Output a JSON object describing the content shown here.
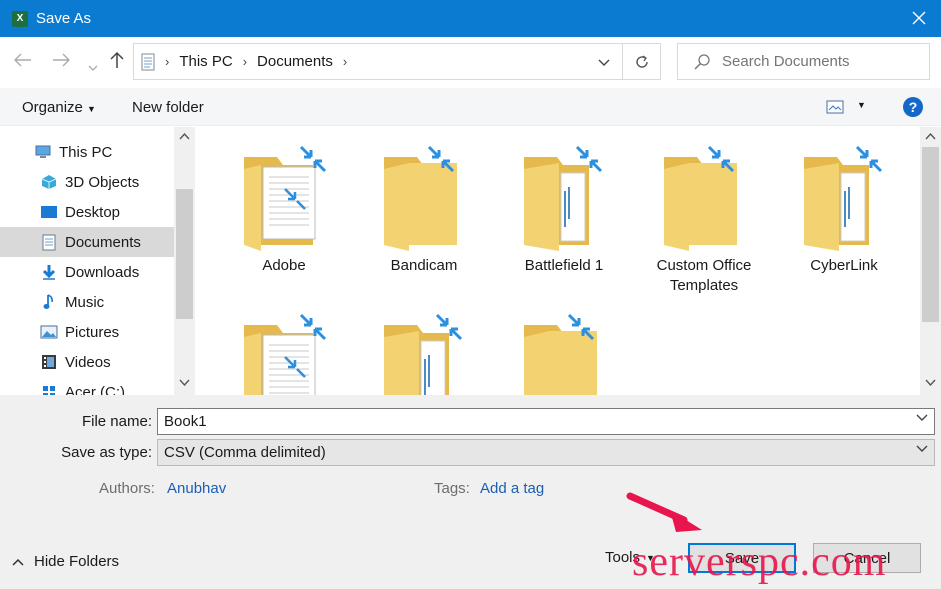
{
  "window": {
    "title": "Save As",
    "app_icon": "excel-icon",
    "close_icon": "close-icon"
  },
  "nav": {
    "back_icon": "back-arrow-icon",
    "forward_icon": "forward-arrow-icon",
    "recent_icon": "chevron-down-icon",
    "up_icon": "up-arrow-icon"
  },
  "address": {
    "crumbs": [
      "This PC",
      "Documents"
    ],
    "refresh_icon": "refresh-icon"
  },
  "search": {
    "placeholder": "Search Documents"
  },
  "toolbar": {
    "organize": "Organize",
    "new_folder": "New folder",
    "view_icon": "view-options-icon",
    "help": "?"
  },
  "sidebar": {
    "items": [
      {
        "label": "This PC",
        "icon": "computer-icon",
        "selected": false
      },
      {
        "label": "3D Objects",
        "icon": "cube-icon",
        "selected": false
      },
      {
        "label": "Desktop",
        "icon": "desktop-icon",
        "selected": false
      },
      {
        "label": "Documents",
        "icon": "document-icon",
        "selected": true
      },
      {
        "label": "Downloads",
        "icon": "download-icon",
        "selected": false
      },
      {
        "label": "Music",
        "icon": "music-icon",
        "selected": false
      },
      {
        "label": "Pictures",
        "icon": "pictures-icon",
        "selected": false
      },
      {
        "label": "Videos",
        "icon": "video-icon",
        "selected": false
      },
      {
        "label": "Acer (C:)",
        "icon": "drive-icon",
        "selected": false
      }
    ]
  },
  "folders": [
    {
      "name": "Adobe",
      "variant": "doc"
    },
    {
      "name": "Bandicam",
      "variant": "plain"
    },
    {
      "name": "Battlefield 1",
      "variant": "pages"
    },
    {
      "name": "Custom Office Templates",
      "variant": "plain"
    },
    {
      "name": "CyberLink",
      "variant": "pages"
    },
    {
      "name": "",
      "variant": "doc"
    },
    {
      "name": "",
      "variant": "pages"
    },
    {
      "name": "",
      "variant": "plain"
    }
  ],
  "form": {
    "file_name_label": "File name:",
    "file_name_value": "Book1",
    "save_type_label": "Save as type:",
    "save_type_value": "CSV (Comma delimited)",
    "authors_label": "Authors:",
    "authors_value": "Anubhav",
    "tags_label": "Tags:",
    "tags_value": "Add a tag"
  },
  "footer": {
    "hide_folders": "Hide Folders",
    "tools": "Tools",
    "save": "Save",
    "cancel": "Cancel"
  },
  "watermark": "serverspc.com",
  "colors": {
    "title_bar": "#0a7bd1",
    "folder": "#f3d271",
    "shortcut_arrow": "#2d8fe0",
    "link": "#1a5fb4",
    "annotation": "#e8164c"
  }
}
